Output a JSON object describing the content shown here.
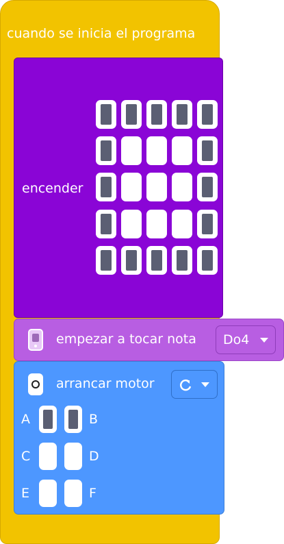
{
  "hat": {
    "title": "cuando se inicia el programa"
  },
  "light": {
    "label": "encender",
    "grid": [
      [
        1,
        1,
        1,
        1,
        1
      ],
      [
        1,
        0,
        0,
        0,
        1
      ],
      [
        1,
        0,
        0,
        0,
        1
      ],
      [
        1,
        0,
        0,
        0,
        1
      ],
      [
        1,
        1,
        1,
        1,
        1
      ]
    ]
  },
  "sound": {
    "label": "empezar a tocar nota",
    "note": "Do4",
    "icon": "speaker-icon"
  },
  "motor": {
    "label": "arrancar motor",
    "icon": "motor-icon",
    "direction_icon": "rotate-clockwise-icon",
    "ports": [
      {
        "left": "A",
        "right": "B",
        "left_on": true,
        "right_on": true
      },
      {
        "left": "C",
        "right": "D",
        "left_on": false,
        "right_on": false
      },
      {
        "left": "E",
        "right": "F",
        "left_on": false,
        "right_on": false
      }
    ]
  }
}
